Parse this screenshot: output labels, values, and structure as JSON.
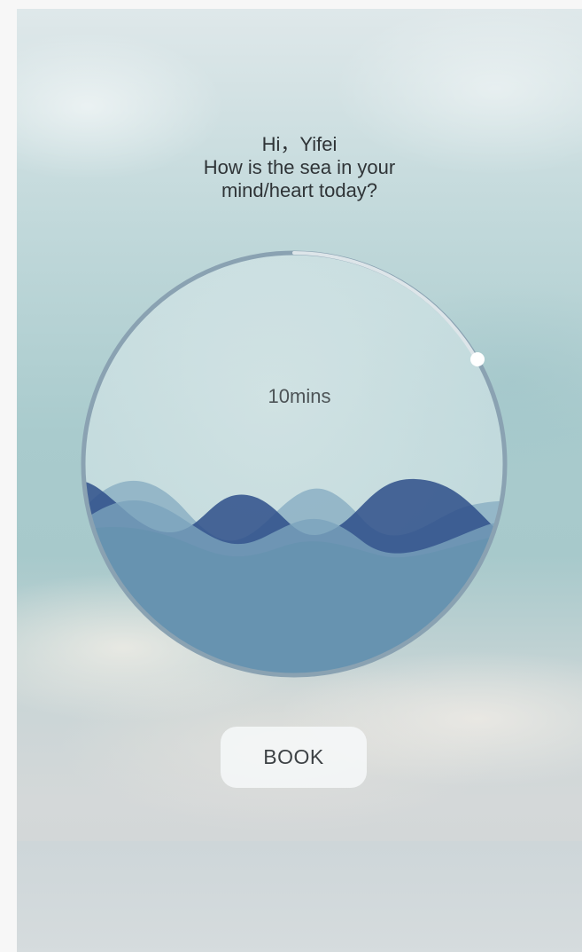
{
  "greeting": {
    "line1": "Hi，Yifei",
    "line2": "How is the sea in your",
    "line3": "mind/heart today?"
  },
  "timer": {
    "label": "10mins"
  },
  "actions": {
    "book_label": "BOOK"
  },
  "colors": {
    "wave_dark": "#2e4f8a",
    "wave_light": "#6793b0",
    "ring": "#8aa2b2",
    "progress_handle": "#ffffff"
  }
}
